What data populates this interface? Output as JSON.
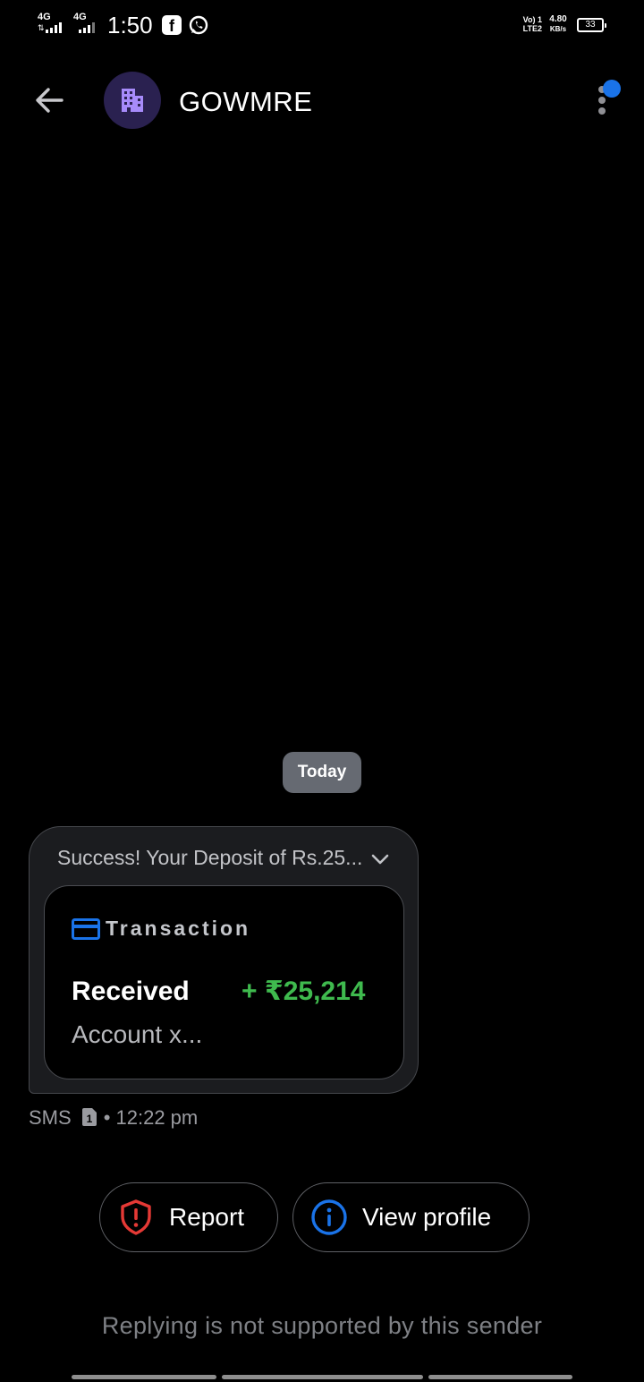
{
  "status_bar": {
    "sim1_network": "4G",
    "sim2_network": "4G",
    "time": "1:50",
    "volte_line1": "Vo) 1",
    "volte_line2": "LTE2",
    "net_speed_value": "4.80",
    "net_speed_unit": "KB/s",
    "battery_level": "33",
    "notification_icons": [
      "facebook-icon",
      "whatsapp-icon"
    ]
  },
  "header": {
    "contact_name": "GOWMRE",
    "avatar_icon": "building-icon",
    "back_icon": "arrow-left-icon",
    "menu_icon": "more-vertical-icon"
  },
  "conversation": {
    "date_chip": "Today",
    "message": {
      "preview": "Success! Your Deposit of Rs.25...",
      "card": {
        "category": "Transaction",
        "status": "Received",
        "amount": "+ ₹25,214",
        "account": "Account x..."
      },
      "meta_channel": "SMS",
      "meta_sim": "1",
      "meta_time": "• 12:22 pm"
    }
  },
  "actions": {
    "report_label": "Report",
    "view_profile_label": "View profile"
  },
  "footer": {
    "notice": "Replying is not supported by this sender"
  },
  "colors": {
    "background": "#000000",
    "accent_blue": "#1a73e8",
    "amount_green": "#3fba4e",
    "report_red": "#e53935",
    "avatar_bg": "#2a2150",
    "avatar_fg": "#a78bfa"
  }
}
